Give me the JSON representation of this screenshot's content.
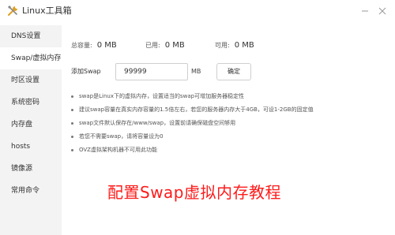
{
  "window": {
    "title": "Linux工具箱",
    "icon": "tools-icon"
  },
  "sidebar": {
    "items": [
      {
        "label": "DNS设置",
        "active": false
      },
      {
        "label": "Swap/虚拟内存",
        "active": true
      },
      {
        "label": "时区设置",
        "active": false
      },
      {
        "label": "系统密码",
        "active": false
      },
      {
        "label": "内存盘",
        "active": false
      },
      {
        "label": "hosts",
        "active": false
      },
      {
        "label": "镜像源",
        "active": false
      },
      {
        "label": "常用命令",
        "active": false
      }
    ]
  },
  "stats": {
    "total_label": "总容量:",
    "total_value": "0 MB",
    "used_label": "已用:",
    "used_value": "0 MB",
    "available_label": "可用:",
    "available_value": "0 MB"
  },
  "swap_form": {
    "label": "添加Swap",
    "value": "99999",
    "unit": "MB",
    "button": "确定"
  },
  "notes": [
    "swap是Linux下的虚拟内存，设置适当的swap可增加服务器稳定性",
    "建议swap容量在真实内存容量的1.5倍左右，若您的服务器内存大于4GB，可设1-2GB的固定值",
    "swap文件默认保存在/www/swap，设置前请确保磁盘空间够用",
    "若您不需要swap，请将容量设为0",
    "OVZ虚拟架构机器不可用此功能"
  ],
  "overlay_caption": "配置Swap虚拟内存教程",
  "colors": {
    "sidebar_bg": "#f3f3f3",
    "caption": "#ff1a1a"
  }
}
